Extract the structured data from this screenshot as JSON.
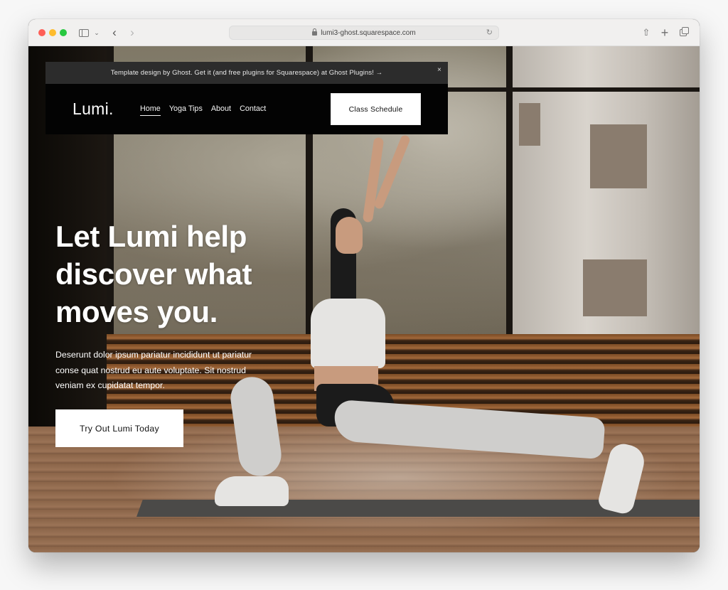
{
  "browser": {
    "url": "lumi3-ghost.squarespace.com",
    "icons": {
      "sidebar": "sidebar-icon",
      "sidebar_menu": "chevron-down-icon",
      "back": "‹",
      "forward": "›",
      "reload": "↻",
      "share": "⇧",
      "new_tab": "+",
      "tabs": "tabs-overview-icon"
    }
  },
  "announcement": {
    "text": "Template design by Ghost. Get it (and free plugins for Squarespace) at Ghost Plugins! →",
    "close": "×"
  },
  "header": {
    "logo": "Lumi.",
    "nav": [
      {
        "label": "Home",
        "active": true
      },
      {
        "label": "Yoga Tips",
        "active": false
      },
      {
        "label": "About",
        "active": false
      },
      {
        "label": "Contact",
        "active": false
      }
    ],
    "cta": "Class Schedule"
  },
  "hero": {
    "title_lines": [
      "Let Lumi help",
      "discover what",
      "moves you."
    ],
    "body_lines": [
      "Deserunt dolor ipsum pariatur incididunt ut pariatur",
      "conse quat nostrud eu aute voluptate. Sit nostrud",
      "veniam ex cupidatat tempor."
    ],
    "cta": "Try Out Lumi Today",
    "image": "woman-doing-yoga-lunge-photo"
  },
  "colors": {
    "announcement_bg": "#2c2c2c",
    "header_bg": "#030303",
    "button_bg": "#ffffff",
    "text_light": "#ffffff"
  }
}
